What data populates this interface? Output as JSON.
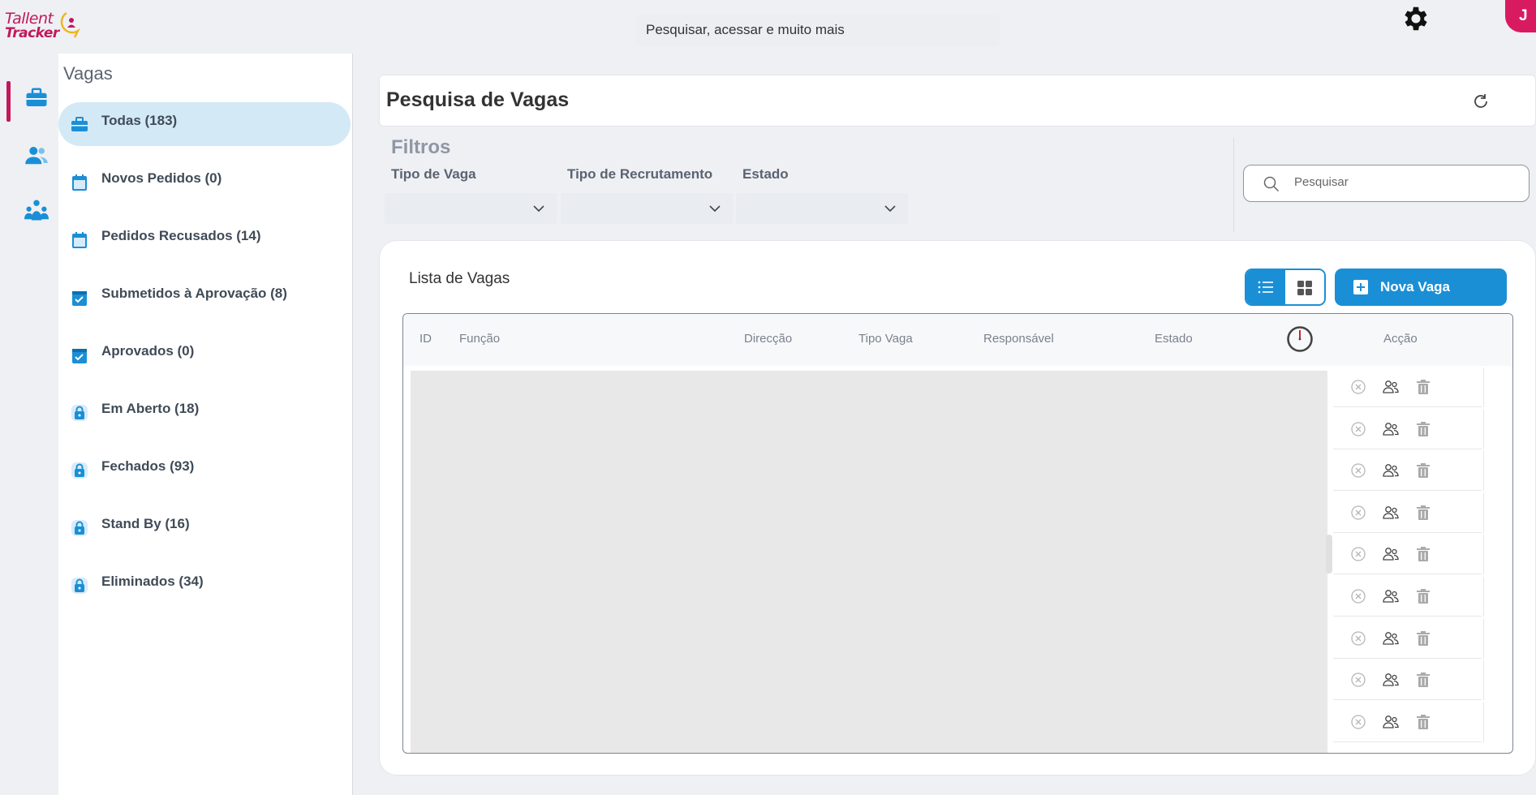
{
  "app": {
    "logo_line1": "Tallent",
    "logo_line2": "Tracker",
    "global_search_placeholder": "Pesquisar, acessar e muito mais",
    "avatar_initial": "J",
    "accent_color": "#c2185b",
    "primary_color": "#1a8fd6"
  },
  "rail": {
    "icons": [
      "briefcase-icon",
      "users-icon",
      "team-icon"
    ]
  },
  "sidebar": {
    "title": "Vagas",
    "items": [
      {
        "label": "Todas (183)",
        "icon": "briefcase-icon",
        "active": true
      },
      {
        "label": "Novos Pedidos (0)",
        "icon": "calendar-icon"
      },
      {
        "label": "Pedidos Recusados (14)",
        "icon": "calendar-icon"
      },
      {
        "label": "Submetidos à Aprovação (8)",
        "icon": "calendar-check-icon"
      },
      {
        "label": "Aprovados (0)",
        "icon": "calendar-check-icon"
      },
      {
        "label": "Em Aberto (18)",
        "icon": "lock-icon"
      },
      {
        "label": "Fechados (93)",
        "icon": "lock-icon"
      },
      {
        "label": "Stand By (16)",
        "icon": "lock-icon"
      },
      {
        "label": "Eliminados (34)",
        "icon": "lock-icon"
      }
    ]
  },
  "main": {
    "title": "Pesquisa de Vagas",
    "filters": {
      "title": "Filtros",
      "fields": [
        {
          "label": "Tipo de Vaga",
          "value": ""
        },
        {
          "label": "Tipo de Recrutamento",
          "value": ""
        },
        {
          "label": "Estado",
          "value": ""
        }
      ],
      "search_placeholder": "Pesquisar"
    },
    "list": {
      "title": "Lista de Vagas",
      "new_button": "Nova Vaga",
      "columns": [
        "ID",
        "Função",
        "Direcção",
        "Tipo Vaga",
        "Responsável",
        "Estado",
        "",
        "Acção"
      ],
      "action_rows": 9
    }
  }
}
